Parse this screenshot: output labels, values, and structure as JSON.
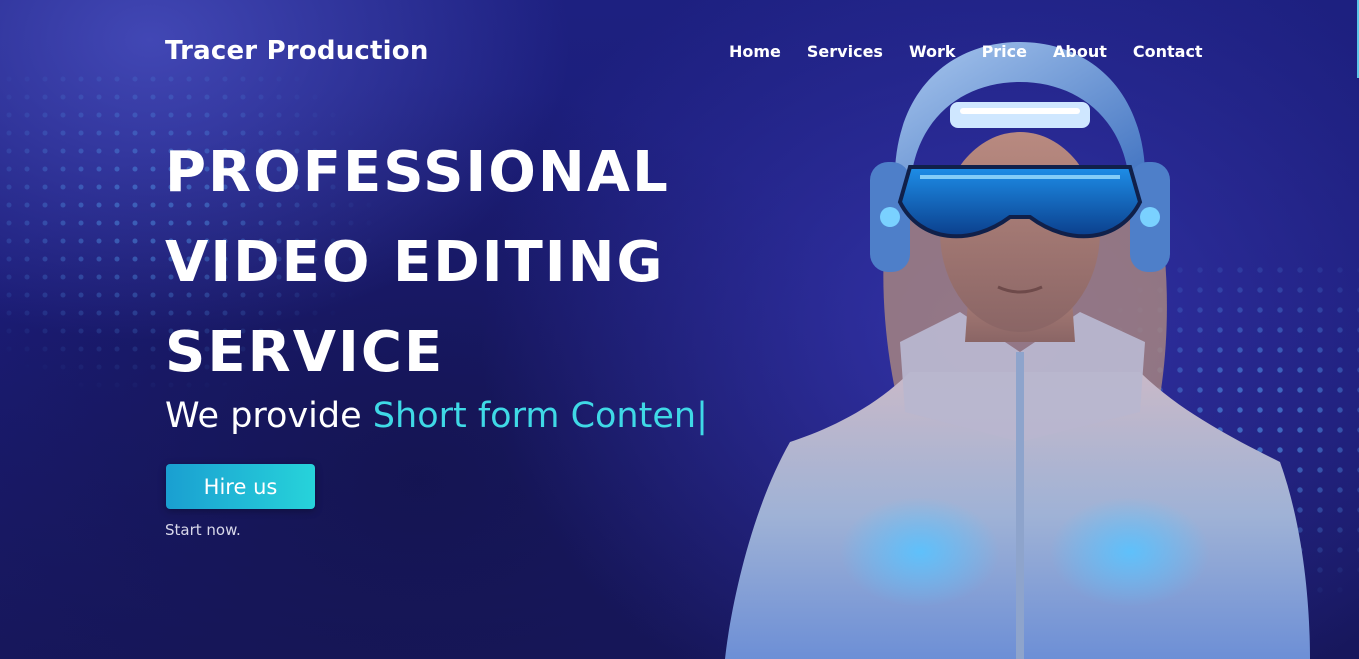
{
  "header": {
    "brand": "Tracer Production",
    "nav": [
      "Home",
      "Services",
      "Work",
      "Price",
      "About",
      "Contact"
    ]
  },
  "hero": {
    "title_lines": [
      "PROFESSIONAL",
      "VIDEO EDITING",
      "SERVICE"
    ],
    "subtitle_prefix": "We provide",
    "subtitle_typed": "Short form Conten",
    "cursor": "|",
    "cta_label": "Hire us",
    "cta_note": "Start now."
  },
  "colors": {
    "background": "#1b1c76",
    "accent": "#3fd9e6",
    "button_start": "#1a9fd1",
    "button_end": "#27d3da"
  },
  "icons": {
    "hero_figure": "vr-helmet-woman-illustration"
  }
}
